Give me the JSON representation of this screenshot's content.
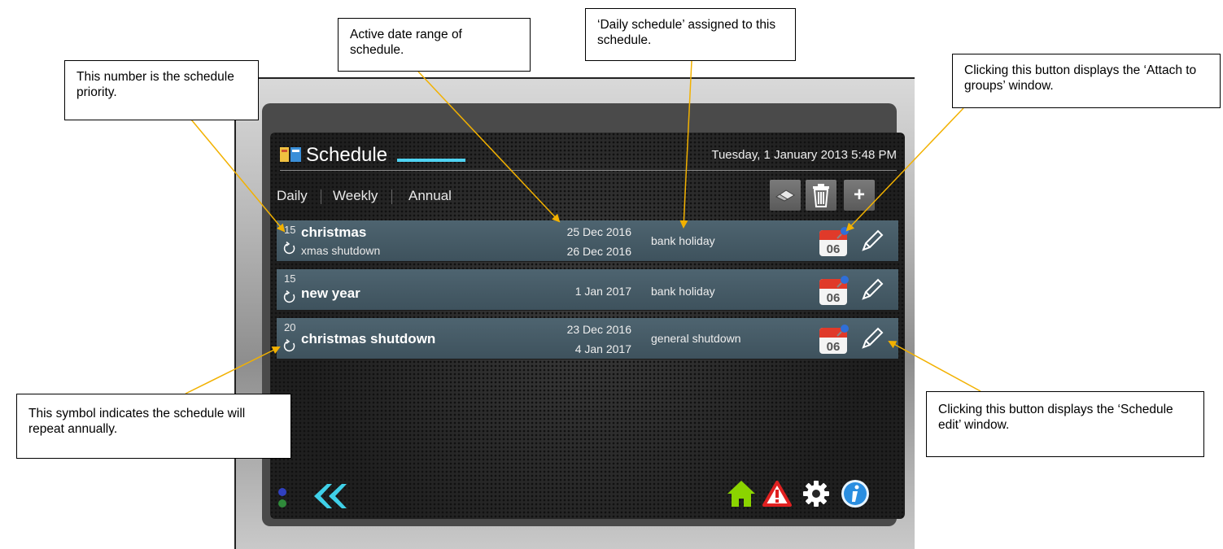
{
  "screen": {
    "title": "Schedule",
    "datetime": "Tuesday, 1 January 2013 5:48 PM"
  },
  "tabs": [
    {
      "label": "Daily"
    },
    {
      "label": "Weekly"
    },
    {
      "label": "Annual"
    }
  ],
  "toolbar": {
    "edit_icon": "eraser-pencil-icon",
    "delete_icon": "trash-icon",
    "add_label": "+"
  },
  "rows": [
    {
      "priority": "15",
      "name": "christmas",
      "description": "xmas shutdown",
      "start": "25 Dec 2016",
      "end": "26 Dec 2016",
      "daily": "bank holiday",
      "calendar_day": "06"
    },
    {
      "priority": "15",
      "name": "new year",
      "description": "",
      "start": "1 Jan 2017",
      "end": "",
      "daily": "bank holiday",
      "calendar_day": "06"
    },
    {
      "priority": "20",
      "name": "christmas shutdown",
      "description": "",
      "start": "23 Dec 2016",
      "end": "4 Jan 2017",
      "daily": "general shutdown",
      "calendar_day": "06"
    }
  ],
  "colors": {
    "accent": "#4fd3f2",
    "row": "#46606c",
    "home": "#8bd400",
    "alert": "#e02020"
  },
  "callouts": {
    "priority": "This number is the schedule priority.",
    "date_range": "Active date range of schedule.",
    "daily_schedule": "‘Daily schedule’ assigned to this schedule.",
    "attach": "Clicking this button displays the ‘Attach to groups’ window.",
    "repeat": "This symbol indicates the schedule will repeat annually.",
    "edit": "Clicking this button displays the ‘Schedule edit’ window."
  }
}
